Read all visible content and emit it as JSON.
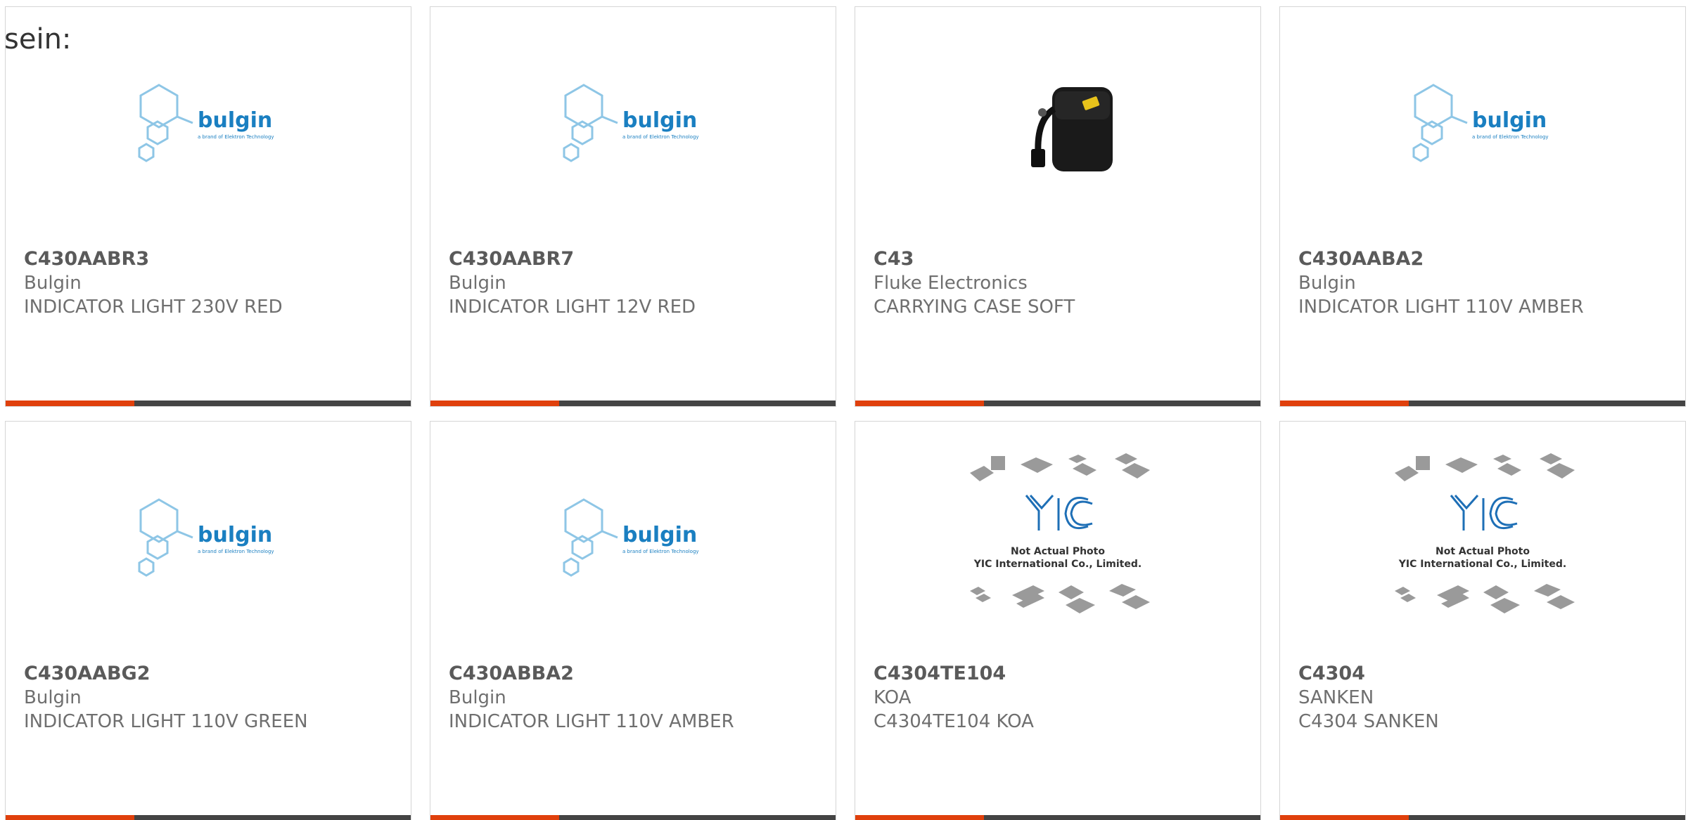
{
  "fragment_text": "sein:",
  "colors": {
    "accent": "#e0400c",
    "bar": "#444444",
    "bulgin_blue": "#1a7fc1",
    "yic_blue": "#1e6fb6"
  },
  "products": [
    {
      "part": "C430AABR3",
      "manufacturer": "Bulgin",
      "description": "INDICATOR LIGHT 230V RED",
      "image": "bulgin-logo"
    },
    {
      "part": "C430AABR7",
      "manufacturer": "Bulgin",
      "description": "INDICATOR LIGHT 12V RED",
      "image": "bulgin-logo"
    },
    {
      "part": "C43",
      "manufacturer": "Fluke Electronics",
      "description": "CARRYING CASE SOFT",
      "image": "carrying-case-photo"
    },
    {
      "part": "C430AABA2",
      "manufacturer": "Bulgin",
      "description": "INDICATOR LIGHT 110V AMBER",
      "image": "bulgin-logo"
    },
    {
      "part": "C430AABG2",
      "manufacturer": "Bulgin",
      "description": "INDICATOR LIGHT 110V GREEN",
      "image": "bulgin-logo"
    },
    {
      "part": "C430ABBA2",
      "manufacturer": "Bulgin",
      "description": "INDICATOR LIGHT 110V AMBER",
      "image": "bulgin-logo"
    },
    {
      "part": "C4304TE104",
      "manufacturer": "KOA",
      "description": "C4304TE104 KOA",
      "image": "yic-placeholder"
    },
    {
      "part": "C4304",
      "manufacturer": "SANKEN",
      "description": "C4304 SANKEN",
      "image": "yic-placeholder"
    }
  ],
  "logos": {
    "bulgin": {
      "word": "bulgin",
      "tagline": "a brand of Elektron Technology"
    },
    "yic": {
      "mark": "YIC",
      "line1": "Not Actual Photo",
      "line2": "YIC International Co., Limited."
    }
  }
}
